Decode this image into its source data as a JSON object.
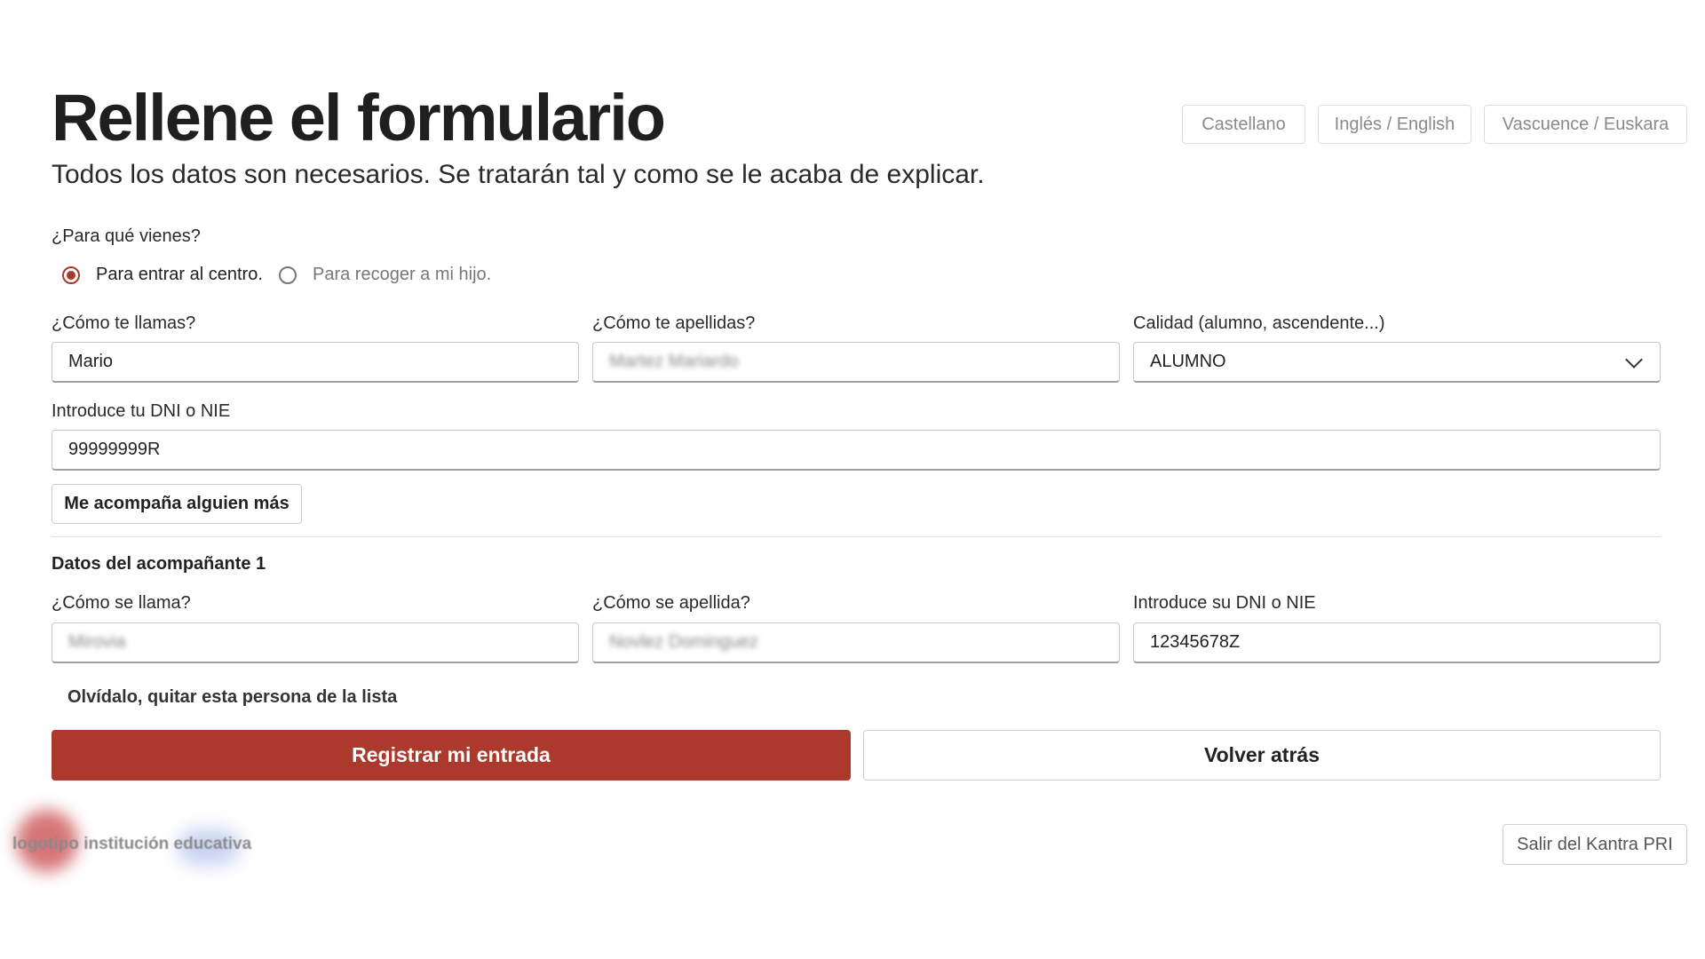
{
  "header": {
    "title": "Rellene el formulario",
    "subtitle": "Todos los datos son necesarios. Se tratarán tal y como se le acaba de explicar."
  },
  "languages": [
    "Castellano",
    "Inglés / English",
    "Vascuence / Euskara"
  ],
  "purpose": {
    "label": "¿Para qué vienes?",
    "options": [
      "Para entrar al centro.",
      "Para recoger a mi hijo."
    ],
    "selected": "Para entrar al centro."
  },
  "form": {
    "name_label": "¿Cómo te llamas?",
    "name_value": "Mario",
    "surname_label": "¿Cómo te apellidas?",
    "surname_value": "Martez Mariardo",
    "quality_label": "Calidad (alumno, ascendente...)",
    "quality_value": "ALUMNO",
    "dni_label": "Introduce tu DNI o NIE",
    "dni_value": "99999999R",
    "add_companion": "Me acompaña alguien más"
  },
  "companion": {
    "title": "Datos del acompañante 1",
    "name_label": "¿Cómo se llama?",
    "name_value": "Mirovia",
    "surname_label": "¿Cómo se apellida?",
    "surname_value": "Novlez Dominguez",
    "dni_label": "Introduce su DNI o NIE",
    "dni_value": "12345678Z",
    "remove": "Olvídalo, quitar esta persona de la lista"
  },
  "actions": {
    "submit": "Registrar mi entrada",
    "back": "Volver atrás"
  },
  "footer": {
    "logo_text": "logotipo institución educativa",
    "exit": "Salir del Kantra PRI"
  },
  "colors": {
    "accent": "#ab3a2c",
    "text": "#222222",
    "muted": "#8a8a8a"
  }
}
